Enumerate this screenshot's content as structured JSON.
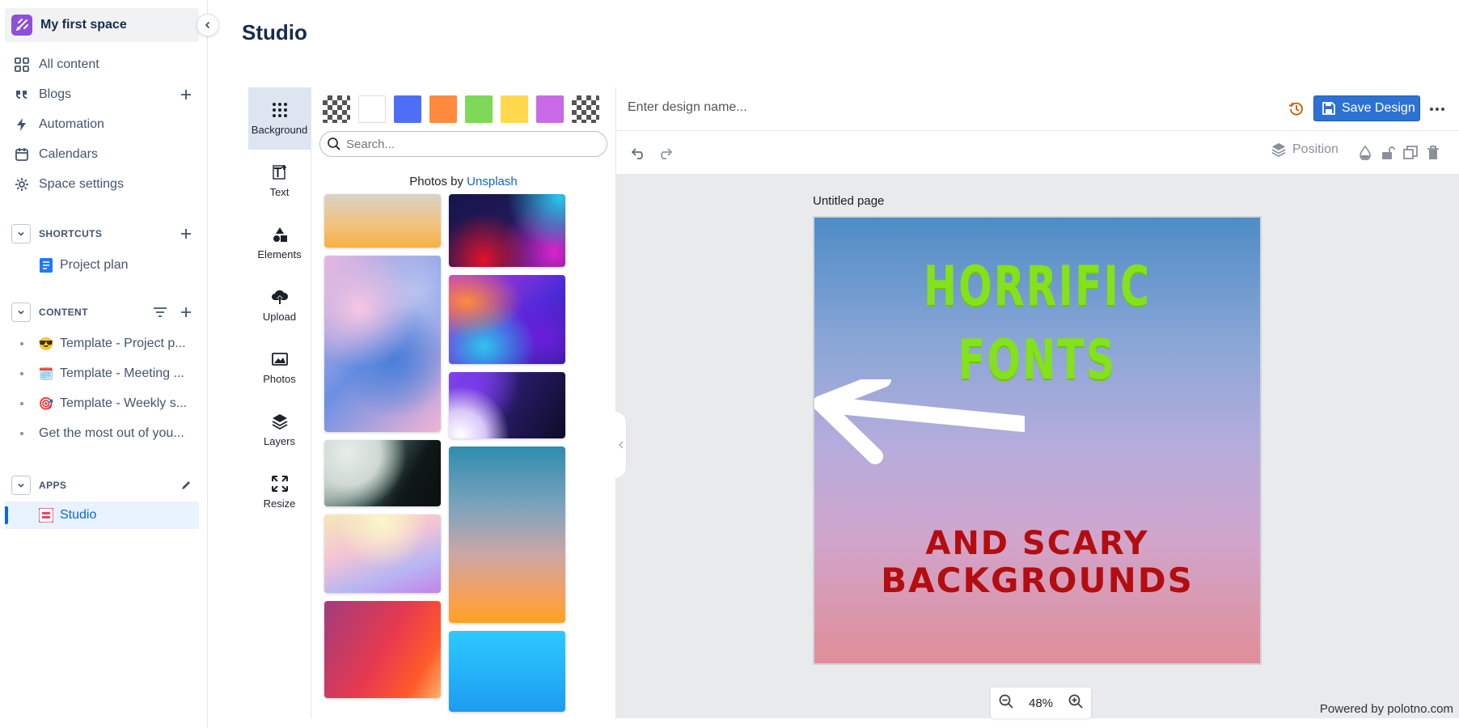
{
  "sidebar": {
    "space_name": "My first space",
    "nav": [
      {
        "label": "All content",
        "icon": "grid-icon"
      },
      {
        "label": "Blogs",
        "icon": "quote-icon"
      },
      {
        "label": "Automation",
        "icon": "lightning-icon"
      },
      {
        "label": "Calendars",
        "icon": "calendar-icon"
      },
      {
        "label": "Space settings",
        "icon": "gear-icon"
      }
    ],
    "shortcuts": {
      "label": "SHORTCUTS",
      "items": [
        {
          "label": "Project plan",
          "icon": "document-icon"
        }
      ]
    },
    "content": {
      "label": "CONTENT",
      "items": [
        {
          "emoji": "😎",
          "label": "Template - Project p..."
        },
        {
          "emoji": "🗓️",
          "label": "Template - Meeting ..."
        },
        {
          "emoji": "🎯",
          "label": "Template - Weekly s..."
        },
        {
          "emoji": "",
          "label": "Get the most out of you..."
        }
      ]
    },
    "apps": {
      "label": "APPS",
      "items": [
        {
          "label": "Studio",
          "icon": "studio-icon",
          "active": true
        }
      ]
    }
  },
  "page": {
    "title": "Studio"
  },
  "studio": {
    "tools": [
      {
        "label": "Background",
        "icon": "dots-grid-icon",
        "active": true
      },
      {
        "label": "Text",
        "icon": "text-icon"
      },
      {
        "label": "Elements",
        "icon": "shapes-icon"
      },
      {
        "label": "Upload",
        "icon": "upload-cloud-icon"
      },
      {
        "label": "Photos",
        "icon": "image-icon"
      },
      {
        "label": "Layers",
        "icon": "layers-icon"
      },
      {
        "label": "Resize",
        "icon": "resize-icon"
      }
    ],
    "swatches": [
      "transparent",
      "#ffffff",
      "#4f6ef7",
      "#ff8a3d",
      "#7dd957",
      "#ffd84d",
      "#c96ae6",
      "transparent"
    ],
    "search_placeholder": "Search...",
    "credits_prefix": "Photos by ",
    "credits_link": "Unsplash",
    "design_name_placeholder": "Enter design name...",
    "save_label": "Save Design",
    "position_label": "Position",
    "page_label": "Untitled page",
    "design_text": {
      "line1": "HORRIFIC",
      "line2": "FONTS",
      "line3": "AND SCARY",
      "line4": "BACKGROUNDS"
    },
    "zoom": "48%",
    "powered_by": "Powered by polotno.com"
  },
  "colors": {
    "accent": "#2d72d2",
    "link": "#1264c8",
    "green_text": "#84e21a",
    "red_text": "#b30d10"
  }
}
